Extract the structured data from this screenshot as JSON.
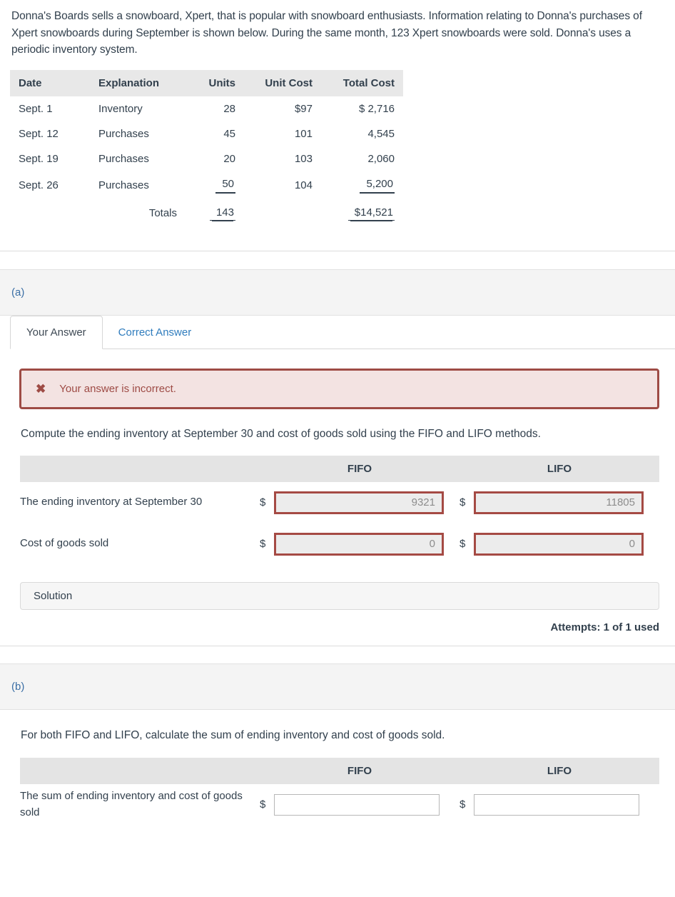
{
  "intro": {
    "text": "Donna's Boards sells a snowboard, Xpert, that is popular with snowboard enthusiasts. Information relating to Donna's purchases of Xpert snowboards during September is shown below. During the same month, 123 Xpert snowboards were sold. Donna's uses a periodic inventory system."
  },
  "purchases_table": {
    "headers": [
      "Date",
      "Explanation",
      "Units",
      "Unit Cost",
      "Total Cost"
    ],
    "rows": [
      {
        "date": "Sept. 1",
        "explanation": "Inventory",
        "units": "28",
        "unit_cost": "$97",
        "total_cost": "$ 2,716"
      },
      {
        "date": "Sept. 12",
        "explanation": "Purchases",
        "units": "45",
        "unit_cost": "101",
        "total_cost": "4,545"
      },
      {
        "date": "Sept. 19",
        "explanation": "Purchases",
        "units": "20",
        "unit_cost": "103",
        "total_cost": "2,060"
      },
      {
        "date": "Sept. 26",
        "explanation": "Purchases",
        "units": "50",
        "unit_cost": "104",
        "total_cost": "5,200"
      }
    ],
    "totals": {
      "date": "",
      "explanation": "Totals",
      "units": "143",
      "unit_cost": "",
      "total_cost": "$14,521"
    }
  },
  "part_a": {
    "label": "(a)",
    "tabs": [
      {
        "label": "Your Answer",
        "active": true
      },
      {
        "label": "Correct Answer",
        "active": false
      }
    ],
    "alert": {
      "icon": "x-mark-icon",
      "message": "Your answer is incorrect."
    },
    "question": "Compute the ending inventory at September 30 and cost of goods sold using the FIFO and LIFO methods.",
    "table": {
      "headers": [
        "",
        "FIFO",
        "LIFO"
      ],
      "rows": [
        {
          "label": "The ending inventory at September 30",
          "currency": "$",
          "fifo": "9321",
          "lifo": "11805"
        },
        {
          "label": "Cost of goods sold",
          "currency": "$",
          "fifo": "0",
          "lifo": "0"
        }
      ]
    },
    "solution_label": "Solution",
    "attempts": "Attempts: 1 of 1 used"
  },
  "part_b": {
    "label": "(b)",
    "question": "For both FIFO and LIFO, calculate the sum of ending inventory and cost of goods sold.",
    "table": {
      "headers": [
        "",
        "FIFO",
        "LIFO"
      ],
      "rows": [
        {
          "label": "The sum of ending inventory and cost of goods sold",
          "currency": "$",
          "fifo": "",
          "lifo": ""
        }
      ]
    }
  },
  "colors": {
    "accent_blue": "#2f7cbd",
    "error_border": "#9e4b45",
    "error_bg": "#f3e3e2",
    "input_error_border": "#a54a44",
    "header_gray": "#e4e4e4",
    "text": "#32404d"
  }
}
